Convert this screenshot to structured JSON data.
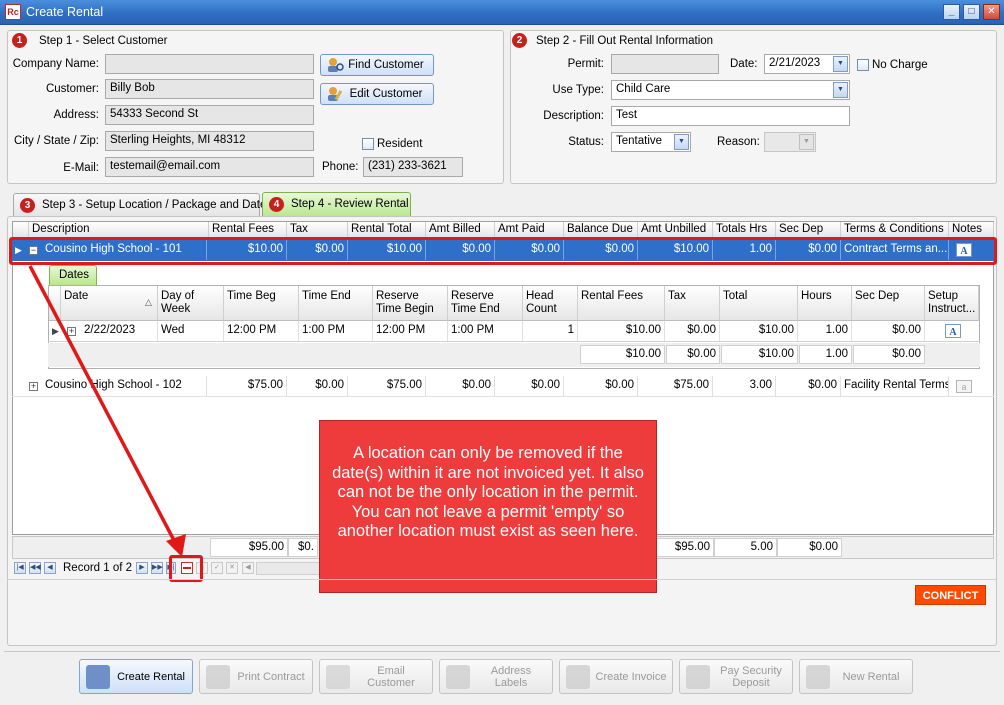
{
  "window": {
    "app_icon": "Rc",
    "title": "Create Rental",
    "controls": {
      "minimize": "_",
      "maximize": "□",
      "close": "✕"
    }
  },
  "step1": {
    "badge": "1",
    "title": "Step 1 - Select Customer",
    "company_label": "Company Name:",
    "company_value": "",
    "customer_label": "Customer:",
    "customer_value": "Billy Bob",
    "address_label": "Address:",
    "address_value": "54333 Second St",
    "city_label": "City / State / Zip:",
    "city_value": "Sterling Heights, MI 48312",
    "email_label": "E-Mail:",
    "email_value": "testemail@email.com",
    "phone_label": "Phone:",
    "phone_value": "(231) 233-3621",
    "resident_label": "Resident",
    "find_customer": "Find Customer",
    "edit_customer": "Edit Customer"
  },
  "step2": {
    "badge": "2",
    "title": "Step 2 - Fill Out Rental Information",
    "permit_label": "Permit:",
    "permit_value": "",
    "date_label": "Date:",
    "date_value": "2/21/2023",
    "no_charge_label": "No Charge",
    "use_type_label": "Use Type:",
    "use_type_value": "Child Care",
    "description_label": "Description:",
    "description_value": "Test",
    "status_label": "Status:",
    "status_value": "Tentative",
    "reason_label": "Reason:"
  },
  "tabs": [
    {
      "badge": "3",
      "label": "Step 3 - Setup Location / Package and Dates"
    },
    {
      "badge": "4",
      "label": "Step 4 - Review Rental"
    }
  ],
  "grid": {
    "columns": [
      "Description",
      "Rental Fees",
      "Tax",
      "Rental Total",
      "Amt Billed",
      "Amt Paid",
      "Balance Due",
      "Amt Unbilled",
      "Totals Hrs",
      "Sec Dep",
      "Terms & Conditions",
      "Notes"
    ],
    "rows": [
      {
        "cells": [
          "Cousino High School - 101",
          "$10.00",
          "$0.00",
          "$10.00",
          "$0.00",
          "$0.00",
          "$0.00",
          "$10.00",
          "1.00",
          "$0.00",
          "Contract Terms an..."
        ]
      },
      {
        "cells": [
          "Cousino High School - 102",
          "$75.00",
          "$0.00",
          "$75.00",
          "$0.00",
          "$0.00",
          "$0.00",
          "$75.00",
          "3.00",
          "$0.00",
          "Facility Rental Terms"
        ]
      }
    ],
    "footer_visible": [
      "$95.00",
      "$0.",
      "$95.00",
      "5.00",
      "$0.00"
    ]
  },
  "dates": {
    "tab_label": "Dates",
    "columns": [
      "Date",
      "Day of Week",
      "Time Beg",
      "Time End",
      "Reserve Time Begin",
      "Reserve Time End",
      "Head Count",
      "Rental Fees",
      "Tax",
      "Total",
      "Hours",
      "Sec Dep",
      "Setup Instruct..."
    ],
    "rows": [
      {
        "cells": [
          "2/22/2023",
          "Wed",
          "12:00 PM",
          "1:00 PM",
          "12:00 PM",
          "1:00 PM",
          "1",
          "$10.00",
          "$0.00",
          "$10.00",
          "1.00",
          "$0.00"
        ]
      }
    ],
    "footer": [
      "$10.00",
      "$0.00",
      "$10.00",
      "1.00",
      "$0.00"
    ]
  },
  "navigator": {
    "record_text": "Record 1 of 2"
  },
  "tooltip": {
    "text": "A location can only be removed if the date(s) within it are not invoiced yet.  It also can not be the only location in the permit.  You can not leave a permit 'empty' so another location must exist as seen here."
  },
  "status": {
    "conflict": "CONFLICT"
  },
  "toolbar": [
    {
      "line1": "Create Rental",
      "line2": ""
    },
    {
      "line1": "Print Contract",
      "line2": ""
    },
    {
      "line1": "Email",
      "line2": "Customer"
    },
    {
      "line1": "Address",
      "line2": "Labels"
    },
    {
      "line1": "Create Invoice",
      "line2": ""
    },
    {
      "line1": "Pay Security",
      "line2": "Deposit"
    },
    {
      "line1": "New Rental",
      "line2": ""
    }
  ],
  "colors": {
    "title_bar": "#2f6fc4",
    "selected_row": "#2e6fc9",
    "highlight_red": "#e02020",
    "tooltip": "#ee3b3b",
    "conflict": "#ff4a00",
    "active_tab": "#b8e68e"
  },
  "icons": [
    "app-icon",
    "find-customer-icon",
    "edit-customer-icon",
    "notes-icon",
    "setup-instructions-icon",
    "remove-record-icon",
    "create-rental-icon",
    "print-contract-icon",
    "email-customer-icon",
    "address-labels-icon",
    "create-invoice-icon",
    "pay-security-deposit-icon",
    "new-rental-icon"
  ]
}
